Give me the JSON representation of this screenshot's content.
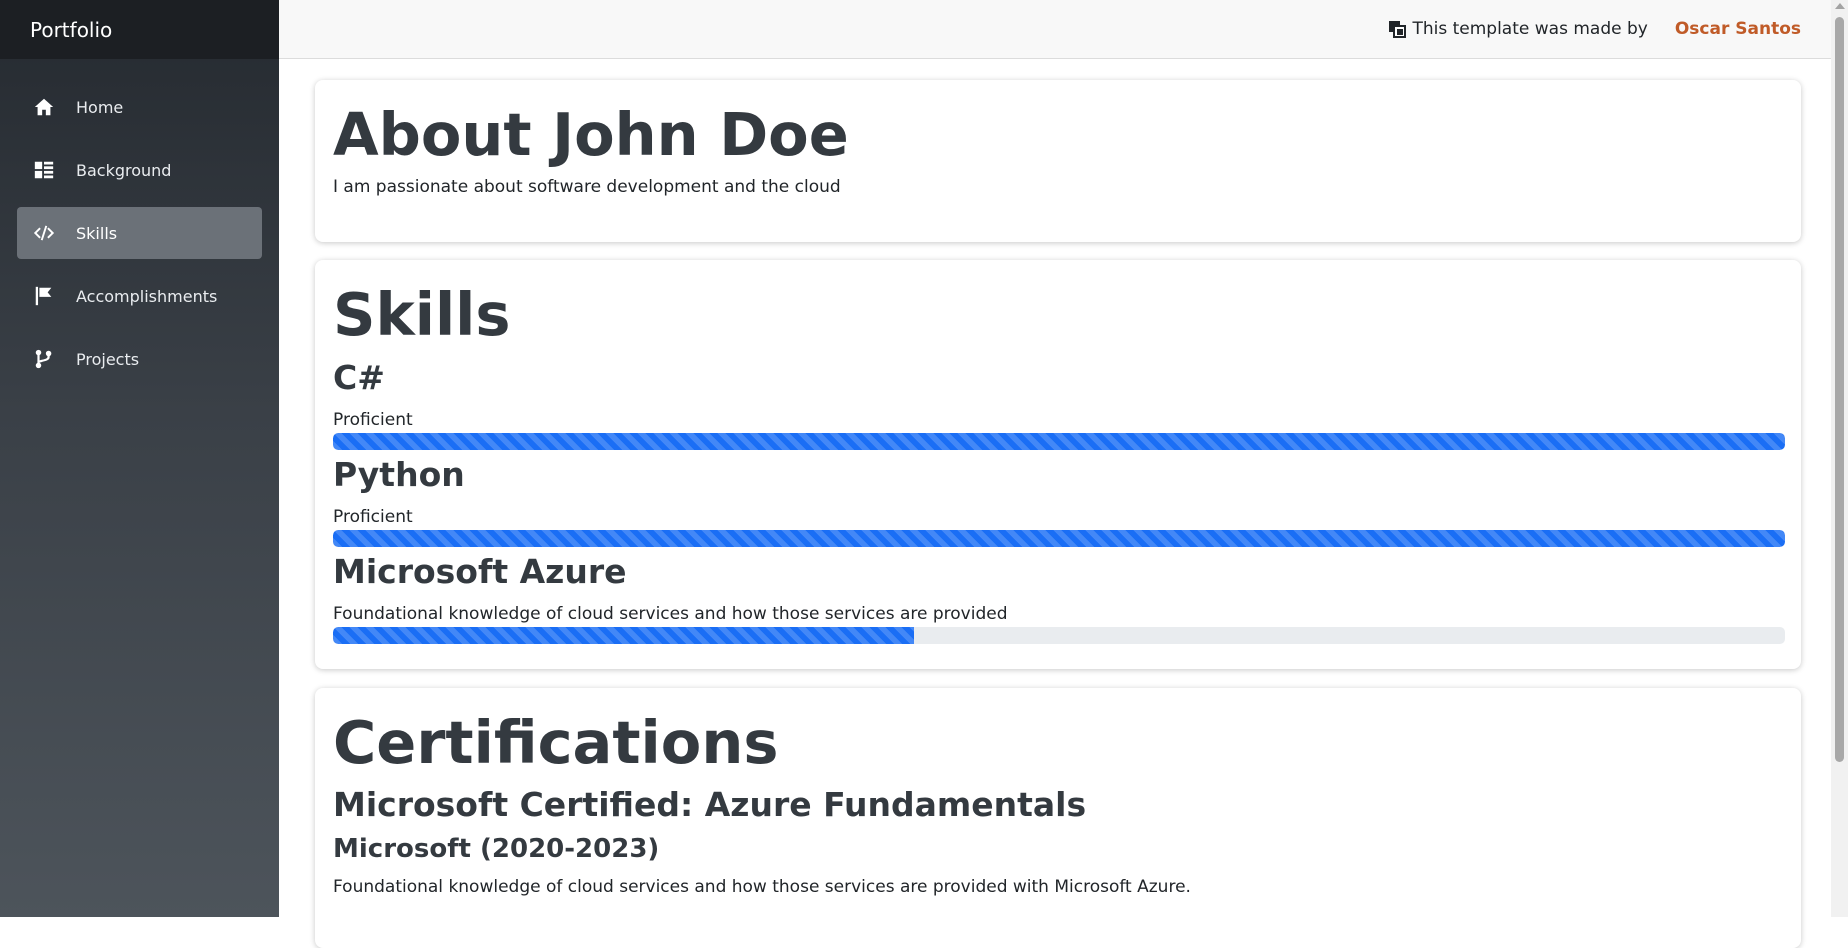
{
  "sidebar": {
    "brand": "Portfolio",
    "items": [
      {
        "label": "Home",
        "icon": "home-icon"
      },
      {
        "label": "Background",
        "icon": "list-icon"
      },
      {
        "label": "Skills",
        "icon": "code-icon",
        "active": true
      },
      {
        "label": "Accomplishments",
        "icon": "flag-icon"
      },
      {
        "label": "Projects",
        "icon": "branch-icon"
      }
    ]
  },
  "header": {
    "credit_text": "This template was made by",
    "credit_author": "Oscar Santos",
    "credit_icon": "copy-icon"
  },
  "about": {
    "title": "About John Doe",
    "text": "I am passionate about software development and the cloud"
  },
  "skills": {
    "title": "Skills",
    "items": [
      {
        "name": "C#",
        "level": "Proficient",
        "progress_percent": 100
      },
      {
        "name": "Python",
        "level": "Proficient",
        "progress_percent": 100
      },
      {
        "name": "Microsoft Azure",
        "level": "Foundational knowledge of cloud services and how those services are provided",
        "progress_percent": 40
      }
    ]
  },
  "certifications": {
    "title": "Certifications",
    "items": [
      {
        "name": "Microsoft Certified: Azure Fundamentals",
        "issuer": "Microsoft (2020-2023)",
        "description": "Foundational knowledge of cloud services and how those services are provided with Microsoft Azure."
      }
    ]
  },
  "colors": {
    "accent": "#1a6ef5",
    "link": "#c05b28",
    "heading": "#343a40"
  }
}
